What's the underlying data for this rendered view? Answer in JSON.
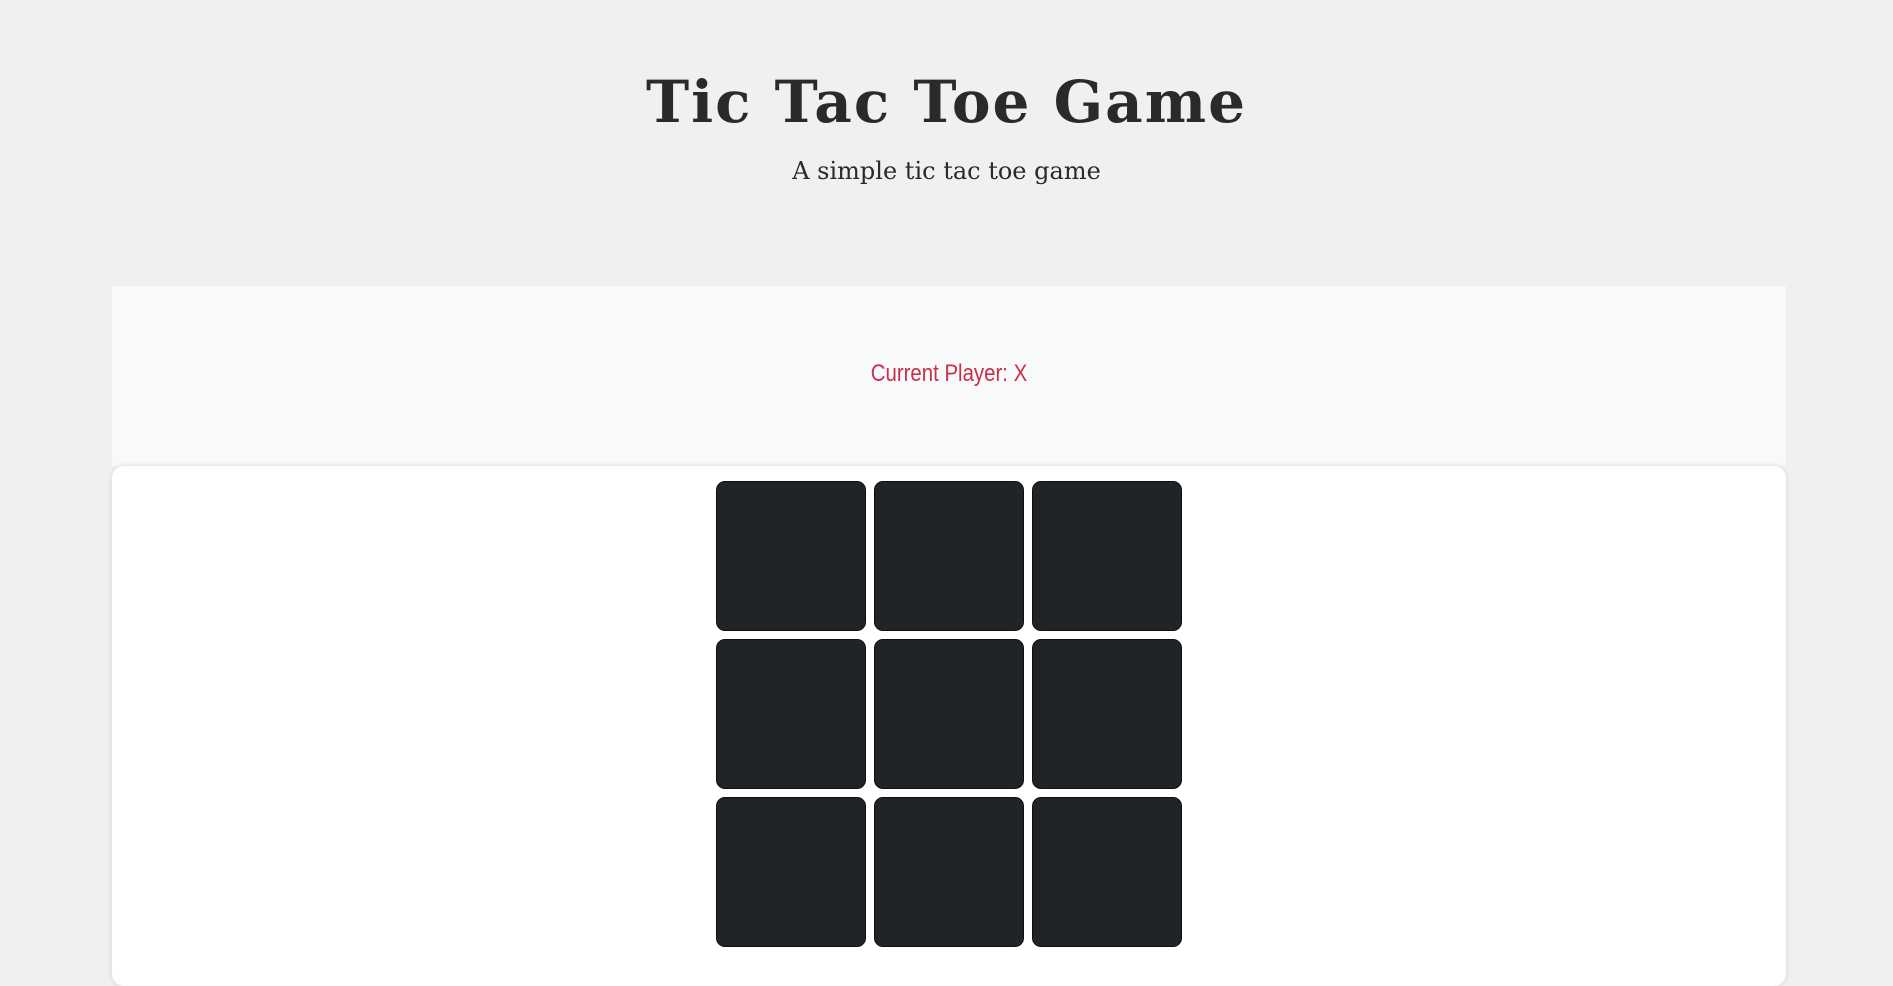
{
  "header": {
    "title": "Tic Tac Toe Game",
    "subtitle": "A simple tic tac toe game"
  },
  "status": {
    "text": "Current Player: X",
    "color": "#c9304a"
  },
  "board": {
    "cells": [
      "",
      "",
      "",
      "",
      "",
      "",
      "",
      "",
      ""
    ],
    "cell_color": "#212427"
  }
}
